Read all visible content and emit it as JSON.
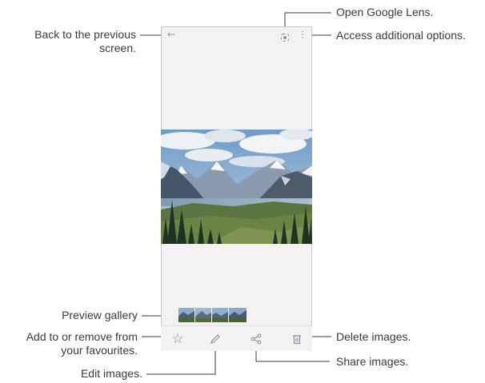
{
  "callouts": {
    "back": "Back to the previous\nscreen.",
    "back_line1": "Back to the previous",
    "back_line2": "screen.",
    "lens": "Open Google Lens.",
    "options": "Access additional options.",
    "preview": "Preview gallery",
    "favourite_line1": "Add to or remove from",
    "favourite_line2": "your favourites.",
    "delete": "Delete images.",
    "share": "Share images.",
    "edit": "Edit images."
  },
  "icons": {
    "back": "←",
    "lens": "lens-icon",
    "more": "⋮",
    "star": "☆",
    "edit": "pencil-icon",
    "share": "share-icon",
    "delete": "trash-icon"
  },
  "colors": {
    "callout_line": "#3a3a3a",
    "icon": "#9a8aa2",
    "screen_bg": "#f2f2f2"
  }
}
